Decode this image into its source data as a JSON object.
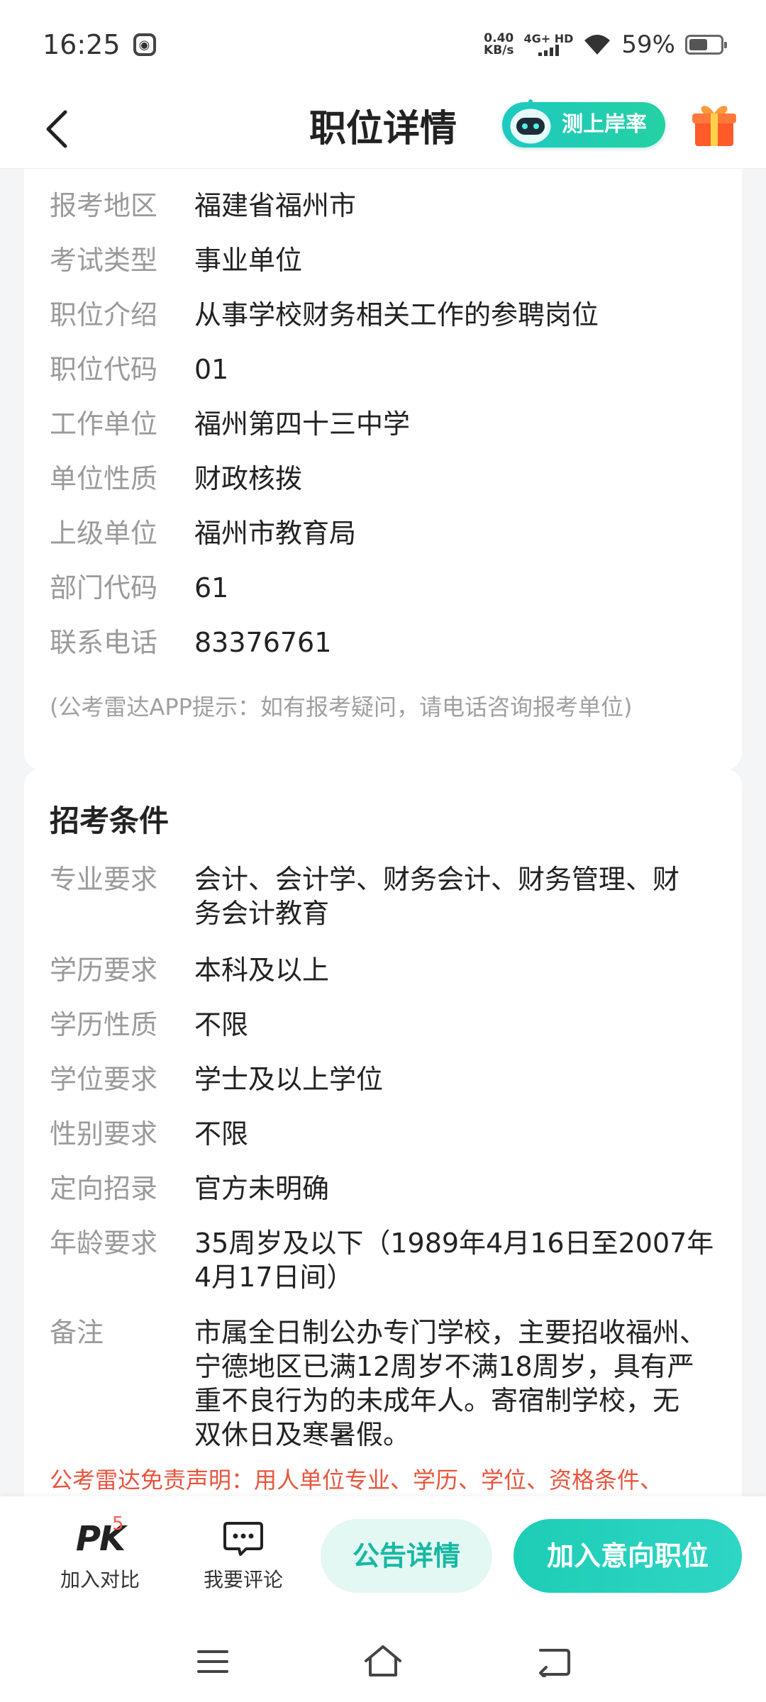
{
  "status_bar": {
    "time": "16:25",
    "net_speed_value": "0.40",
    "net_speed_unit": "KB/s",
    "network_type": "4G+ HD",
    "battery_percent": "59%",
    "battery_level": 0.59
  },
  "nav": {
    "title": "职位详情",
    "rate_button_label": "测上岸率"
  },
  "basic_info": {
    "rows": [
      {
        "label": "报考地区",
        "value": "福建省福州市"
      },
      {
        "label": "考试类型",
        "value": "事业单位"
      },
      {
        "label": "职位介绍",
        "value": "从事学校财务相关工作的参聘岗位"
      },
      {
        "label": "职位代码",
        "value": "01"
      },
      {
        "label": "工作单位",
        "value": "福州第四十三中学"
      },
      {
        "label": "单位性质",
        "value": "财政核拨"
      },
      {
        "label": "上级单位",
        "value": "福州市教育局"
      },
      {
        "label": "部门代码",
        "value": "61"
      },
      {
        "label": "联系电话",
        "value": "83376761"
      }
    ],
    "hint": "(公考雷达APP提示：如有报考疑问，请电话咨询报考单位)"
  },
  "conditions": {
    "title": "招考条件",
    "rows": [
      {
        "label": "专业要求",
        "value_lines": [
          "会计、会计学、财务会计、财务管理、财",
          "务会计教育"
        ]
      },
      {
        "label": "学历要求",
        "value_lines": [
          "本科及以上"
        ]
      },
      {
        "label": "学历性质",
        "value_lines": [
          "不限"
        ]
      },
      {
        "label": "学位要求",
        "value_lines": [
          "学士及以上学位"
        ]
      },
      {
        "label": "性别要求",
        "value_lines": [
          "不限"
        ]
      },
      {
        "label": "定向招录",
        "value_lines": [
          "官方未明确"
        ]
      },
      {
        "label": "年龄要求",
        "value_lines": [
          "35周岁及以下（1989年4月16日至2007年",
          "4月17日间）"
        ]
      },
      {
        "label": "备注",
        "value_lines": [
          "市属全日制公办专门学校，主要招收福州、",
          "宁德地区已满12周岁不满18周岁，具有严",
          "重不良行为的未成年人。寄宿制学校，无",
          "双休日及寒暑假。"
        ]
      }
    ],
    "disclaimer": "公考雷达免责声明：用人单位专业、学历、学位、资格条件、"
  },
  "bottom_bar": {
    "compare_icon_text": "PK",
    "compare_count": "5",
    "compare_label": "加入对比",
    "comment_label": "我要评论",
    "notice_button": "公告详情",
    "join_button": "加入意向职位"
  },
  "colors": {
    "accent": "#1ecdb6",
    "warning_text": "#e8553e",
    "label_gray": "#9a9a9a"
  }
}
